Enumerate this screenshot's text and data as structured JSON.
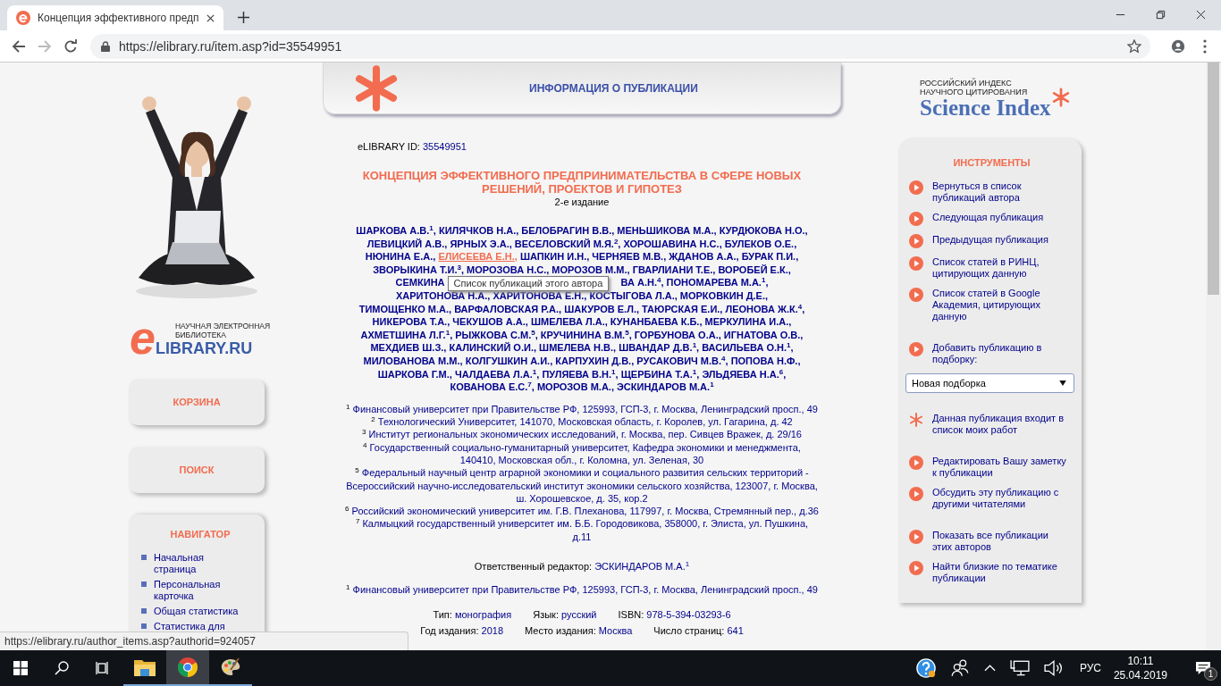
{
  "browser": {
    "tab_title": "Концепция эффективного предп",
    "url": "https://elibrary.ru/item.asp?id=35549951",
    "status_url": "https://elibrary.ru/author_items.asp?authorid=924057"
  },
  "left": {
    "buttons": [
      "КОРЗИНА",
      "ПОИСК"
    ],
    "logo_caption": "НАУЧНАЯ ЭЛЕКТРОННАЯ БИБЛИОТЕКА",
    "logo_letter": "e",
    "logo_word": "LIBRARY.RU",
    "navigator": {
      "title": "НАВИГАТОР",
      "items": [
        "Начальная страница",
        "Персональная карточка",
        "Общая статистика",
        "Статистика для"
      ]
    }
  },
  "header": {
    "title": "ИНФОРМАЦИЯ О ПУБЛИКАЦИИ"
  },
  "publication": {
    "id_label": "eLIBRARY ID:",
    "id": "35549951",
    "title": "КОНЦЕПЦИЯ ЭФФЕКТИВНОГО ПРЕДПРИНИМАТЕЛЬСТВА В СФЕРЕ НОВЫХ РЕШЕНИЙ, ПРОЕКТОВ И ГИПОТЕЗ",
    "edition": "2-е издание",
    "author_lines": [
      [
        {
          "kind": "author",
          "text": "ШАРКОВА А.В.$^{1}$",
          "sep": ",",
          "hovered": false
        },
        {
          "kind": "author",
          "text": "КИЛЯЧКОВ Н.А.",
          "sep": ",",
          "hovered": false
        },
        {
          "kind": "author",
          "text": "БЕЛОБРАГИН В.В.",
          "sep": ",",
          "hovered": false
        },
        {
          "kind": "author",
          "text": "МЕНЬШИКОВА М.А.",
          "sep": ",",
          "hovered": false
        },
        {
          "kind": "author",
          "text": "КУРДЮКОВА Н.О.",
          "sep": ",",
          "hovered": false
        }
      ],
      [
        {
          "kind": "author",
          "text": "ЛЕВИЦКИЙ А.В.",
          "sep": ",",
          "hovered": false
        },
        {
          "kind": "author",
          "text": "ЯРНЫХ Э.А.",
          "sep": ",",
          "hovered": false
        },
        {
          "kind": "author",
          "text": "ВЕСЕЛОВСКИЙ М.Я.$^{2}$",
          "sep": ",",
          "hovered": false
        },
        {
          "kind": "author",
          "text": "ХОРОШАВИНА Н.С.",
          "sep": ",",
          "hovered": false
        },
        {
          "kind": "author",
          "text": "БУЛЕКОВ О.Е.",
          "sep": ",",
          "hovered": false
        }
      ],
      [
        {
          "kind": "author",
          "text": "НЮНИНА Е.А.",
          "sep": ",",
          "hovered": false
        },
        {
          "kind": "author",
          "text": "ЕЛИСЕЕВА Е.Н.",
          "sep": ",",
          "hovered": true
        },
        {
          "kind": "author",
          "text": "ШАПКИН И.Н.",
          "sep": ",",
          "hovered": false
        },
        {
          "kind": "author",
          "text": "ЧЕРНЯЕВ М.В.",
          "sep": ",",
          "hovered": false
        },
        {
          "kind": "author",
          "text": "ЖДАНОВ А.А.",
          "sep": ",",
          "hovered": false
        },
        {
          "kind": "author",
          "text": "БУРАК П.И.",
          "sep": ",",
          "hovered": false
        }
      ],
      [
        {
          "kind": "author",
          "text": "ЗВОРЫКИНА Т.И.$^{3}$",
          "sep": ",",
          "hovered": false
        },
        {
          "kind": "author",
          "text": "МОРОЗОВА Н.С.",
          "sep": ",",
          "hovered": false
        },
        {
          "kind": "author",
          "text": "МОРОЗОВ М.М.",
          "sep": ",",
          "hovered": false
        },
        {
          "kind": "author",
          "text": "ГВАРЛИАНИ Т.Е.",
          "sep": ",",
          "hovered": false
        },
        {
          "kind": "author",
          "text": "ВОРОБЕЙ Е.К.",
          "sep": ",",
          "hovered": false
        }
      ],
      [
        {
          "kind": "author",
          "text": "СЕМКИНА",
          "hovered": false
        },
        {
          "kind": "covered",
          "tooltip": "Список публикаций этого автора"
        },
        {
          "kind": "author",
          "text": "ВА А.Н.$^{4}$",
          "sep": ",",
          "hovered": false
        },
        {
          "kind": "author",
          "text": "ПОНОМАРЕВА М.А.$^{1}$",
          "sep": ",",
          "hovered": false
        }
      ],
      [
        {
          "kind": "author",
          "text": "ХАРИТОНОВА Н.А.",
          "sep": ",",
          "hovered": false
        },
        {
          "kind": "author",
          "text": "ХАРИТОНОВА Е.Н.",
          "sep": ",",
          "hovered": false
        },
        {
          "kind": "author",
          "text": "КОСТЫГОВА Л.А.",
          "sep": ",",
          "hovered": false
        },
        {
          "kind": "author",
          "text": "МОРКОВКИН Д.Е.",
          "sep": ",",
          "hovered": false
        }
      ],
      [
        {
          "kind": "author",
          "text": "ТИМОЩЕНКО М.А.",
          "sep": ",",
          "hovered": false
        },
        {
          "kind": "author",
          "text": "ВАРФАЛОВСКАЯ Р.А.",
          "sep": ",",
          "hovered": false
        },
        {
          "kind": "author",
          "text": "ШАКУРОВ Е.Л.",
          "sep": ",",
          "hovered": false
        },
        {
          "kind": "author",
          "text": "ТАЮРСКАЯ Е.И.",
          "sep": ",",
          "hovered": false
        },
        {
          "kind": "author",
          "text": "ЛЕОНОВА Ж.К.$^{4}$",
          "sep": ",",
          "hovered": false
        }
      ],
      [
        {
          "kind": "author",
          "text": "НИКЕРОВА Т.А.",
          "sep": ",",
          "hovered": false
        },
        {
          "kind": "author",
          "text": "ЧЕКУШОВ А.А.",
          "sep": ",",
          "hovered": false
        },
        {
          "kind": "author",
          "text": "ШМЕЛЕВА Л.А.",
          "sep": ",",
          "hovered": false
        },
        {
          "kind": "author",
          "text": "КУНАНБАЕВА К.Б.",
          "sep": ",",
          "hovered": false
        },
        {
          "kind": "author",
          "text": "МЕРКУЛИНА И.А.",
          "sep": ",",
          "hovered": false
        }
      ],
      [
        {
          "kind": "author",
          "text": "АХМЕТШИНА Л.Г.$^{1}$",
          "sep": ",",
          "hovered": false
        },
        {
          "kind": "author",
          "text": "РЫЖКОВА С.М.$^{5}$",
          "sep": ",",
          "hovered": false
        },
        {
          "kind": "author",
          "text": "КРУЧИНИНА В.М.$^{5}$",
          "sep": ",",
          "hovered": false
        },
        {
          "kind": "author",
          "text": "ГОРБУНОВА О.А.",
          "sep": ",",
          "hovered": false
        },
        {
          "kind": "author",
          "text": "ИГНАТОВА О.В.",
          "sep": ",",
          "hovered": false
        }
      ],
      [
        {
          "kind": "author",
          "text": "МЕХДИЕВ Ш.З.",
          "sep": ",",
          "hovered": false
        },
        {
          "kind": "author",
          "text": "КАЛИНСКИЙ О.И.",
          "sep": ",",
          "hovered": false
        },
        {
          "kind": "author",
          "text": "ШМЕЛЕВА Н.В.",
          "sep": ",",
          "hovered": false
        },
        {
          "kind": "author",
          "text": "ШВАНДАР Д.В.$^{1}$",
          "sep": ",",
          "hovered": false
        },
        {
          "kind": "author",
          "text": "ВАСИЛЬЕВА О.Н.$^{1}$",
          "sep": ",",
          "hovered": false
        }
      ],
      [
        {
          "kind": "author",
          "text": "МИЛОВАНОВА М.М.",
          "sep": ",",
          "hovered": false
        },
        {
          "kind": "author",
          "text": "КОЛГУШКИН А.И.",
          "sep": ",",
          "hovered": false
        },
        {
          "kind": "author",
          "text": "КАРПУХИН Д.В.",
          "sep": ",",
          "hovered": false
        },
        {
          "kind": "author",
          "text": "РУСАКОВИЧ М.В.$^{4}$",
          "sep": ",",
          "hovered": false
        },
        {
          "kind": "author",
          "text": "ПОПОВА Н.Ф.",
          "sep": ",",
          "hovered": false
        }
      ],
      [
        {
          "kind": "author",
          "text": "ШАРКОВА Г.М.",
          "sep": ",",
          "hovered": false
        },
        {
          "kind": "author",
          "text": "ЧАЛДАЕВА Л.А.$^{1}$",
          "sep": ",",
          "hovered": false
        },
        {
          "kind": "author",
          "text": "ПУЛЯЕВА В.Н.$^{1}$",
          "sep": ",",
          "hovered": false
        },
        {
          "kind": "author",
          "text": "ЩЕРБИНА Т.А.$^{1}$",
          "sep": ",",
          "hovered": false
        },
        {
          "kind": "author",
          "text": "ЭЛЬДЯЕВА Н.А.$^{6}$",
          "sep": ",",
          "hovered": false
        }
      ],
      [
        {
          "kind": "author",
          "text": "КОВАНОВА Е.С.$^{7}$",
          "sep": ",",
          "hovered": false
        },
        {
          "kind": "author",
          "text": "МОРОЗОВ М.А.",
          "sep": ",",
          "hovered": false
        },
        {
          "kind": "author",
          "text": "ЭСКИНДАРОВ М.А.$^{1}$",
          "hovered": false
        }
      ]
    ],
    "affiliations": [
      {
        "num": "1",
        "text": "Финансовый университет при Правительстве РФ, 125993, ГСП-3, г. Москва, Ленинградский просп., 49"
      },
      {
        "num": "2",
        "text": "Технологический Университет, 141070, Московская область, г. Королев, ул. Гагарина, д. 42"
      },
      {
        "num": "3",
        "text": "Институт региональных экономических исследований, г. Москва, пер. Сивцев Вражек, д. 29/16"
      },
      {
        "num": "4",
        "text": "Государственный социально-гуманитарный университет, Кафедра экономики и менеджмента, 140410, Московская обл., г. Коломна, ул. Зеленая, 30"
      },
      {
        "num": "5",
        "text": "Федеральный научный центр аграрной экономики и социального развития сельских территорий - Всероссийский научно-исследовательский институт экономики сельского хозяйства, 123007, г. Москва, ш. Хорошевское, д. 35, кор.2"
      },
      {
        "num": "6",
        "text": "Российский экономический университет им. Г.В. Плеханова, 117997, г. Москва, Стремянный пер., д.36"
      },
      {
        "num": "7",
        "text": "Калмыцкий государственный университет им. Б.Б. Городовикова, 358000, г. Элиста, ул. Пушкина, д.11"
      }
    ],
    "editor_label": "Ответственный редактор:",
    "editor": "ЭСКИНДАРОВ М.А.$^{1}$",
    "editor_affiliations": [
      {
        "num": "1",
        "text": "Финансовый университет при Правительстве РФ, 125993, ГСП-3, г. Москва, Ленинградский просп., 49"
      }
    ],
    "details": [
      [
        {
          "label": "Тип:",
          "value": "монография"
        },
        {
          "label": "Язык:",
          "value": "русский"
        },
        {
          "label": "ISBN:",
          "value": "978-5-394-03293-6"
        }
      ],
      [
        {
          "label": "Год издания:",
          "value": "2018"
        },
        {
          "label": "Место издания:",
          "value": "Москва"
        },
        {
          "label": "Число страниц:",
          "value": "641"
        }
      ]
    ]
  },
  "right": {
    "logo_top": "РОССИЙСКИЙ ИНДЕКС НАУЧНОГО ЦИТИРОВАНИЯ",
    "logo_name": "Science Index",
    "tools_title": "ИНСТРУМЕНТЫ",
    "tool_groups": [
      [
        {
          "kind": "link",
          "text": "Вернуться в список публикаций автора"
        },
        {
          "kind": "link",
          "text": "Следующая публикация"
        },
        {
          "kind": "link",
          "text": "Предыдущая публикация"
        },
        {
          "kind": "link",
          "text": "Список статей в РИНЦ, цитирующих данную"
        },
        {
          "kind": "link",
          "text": "Список статей в Google Академия, цитирующих данную"
        }
      ],
      [
        {
          "kind": "link",
          "text": "Добавить публикацию в подборку:"
        },
        {
          "kind": "select",
          "text": "Новая подборка"
        }
      ],
      [
        {
          "kind": "star",
          "text": "Данная публикация входит в список моих работ"
        }
      ],
      [
        {
          "kind": "link",
          "text": "Редактировать Вашу заметку к публикации"
        },
        {
          "kind": "link",
          "text": "Обсудить эту публикацию с другими читателями"
        }
      ],
      [
        {
          "kind": "link",
          "text": "Показать все публикации этих авторов"
        },
        {
          "kind": "link",
          "text": "Найти близкие по тематике публикации"
        }
      ]
    ]
  },
  "taskbar": {
    "apps": [
      {
        "kind": "explorer",
        "selected": false
      },
      {
        "kind": "chrome",
        "selected": true
      },
      {
        "kind": "paint",
        "selected": false
      }
    ],
    "language": "РУС",
    "time": "10:11",
    "date": "25.04.2019",
    "notifications": "1"
  }
}
